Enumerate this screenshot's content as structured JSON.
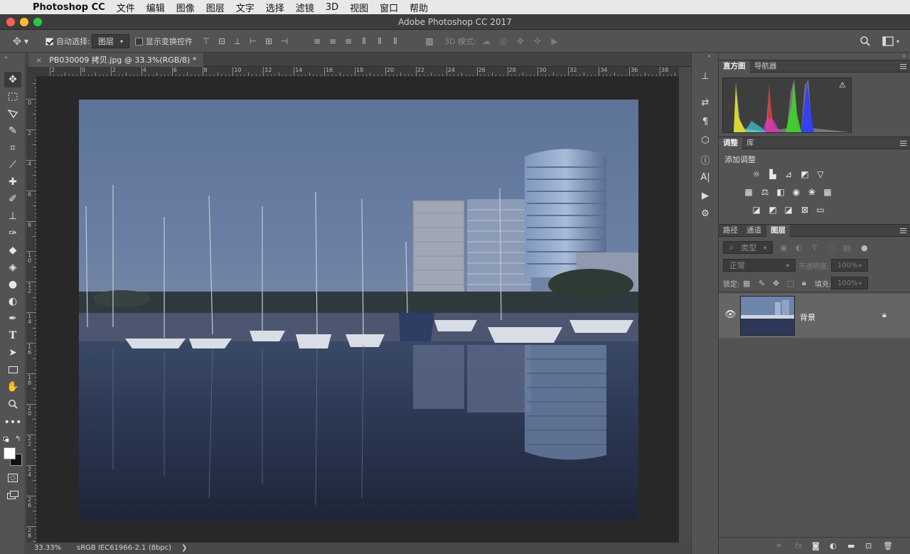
{
  "menubar": {
    "app": "Photoshop CC",
    "items": [
      "文件",
      "编辑",
      "图像",
      "图层",
      "文字",
      "选择",
      "滤镜",
      "3D",
      "视图",
      "窗口",
      "帮助"
    ]
  },
  "window": {
    "title": "Adobe Photoshop CC 2017"
  },
  "options": {
    "auto_select_label": "自动选择:",
    "auto_select_value": "图层",
    "show_transform_label": "显示变换控件",
    "mode_3d_label": "3D 模式:"
  },
  "document": {
    "tab_title": "PB030009 拷贝.jpg @ 33.3%(RGB/8) *",
    "zoom": "33.33%",
    "profile": "sRGB IEC61966-2.1 (8bpc)",
    "status_arrow": "❯"
  },
  "ruler": {
    "h": [
      "2",
      "0",
      "2",
      "4",
      "6",
      "8",
      "10",
      "12",
      "14",
      "16",
      "18",
      "20",
      "22",
      "24",
      "26",
      "28",
      "30",
      "32",
      "34",
      "36",
      "38"
    ],
    "v": [
      "2",
      "0",
      "2",
      "4",
      "6",
      "8",
      "1\n0",
      "1\n2",
      "1\n4",
      "1\n6",
      "1\n8",
      "2\n0",
      "2\n2",
      "2\n4",
      "2\n6",
      "2\n8"
    ]
  },
  "panels": {
    "histogram_tabs": [
      "直方图",
      "导航器"
    ],
    "adjust_tabs": [
      "调整",
      "库"
    ],
    "adjust_title": "添加调整",
    "layers_tabs": [
      "路径",
      "通道",
      "图层"
    ],
    "kind_label": "类型",
    "blend_mode": "正常",
    "opacity_label": "不透明度:",
    "opacity_value": "100%",
    "lock_label": "锁定:",
    "fill_label": "填充:",
    "fill_value": "100%",
    "layer_name": "背景",
    "warn": "⚠"
  },
  "colors": {
    "accent": "#2f6fd6",
    "bg": "#535353"
  }
}
